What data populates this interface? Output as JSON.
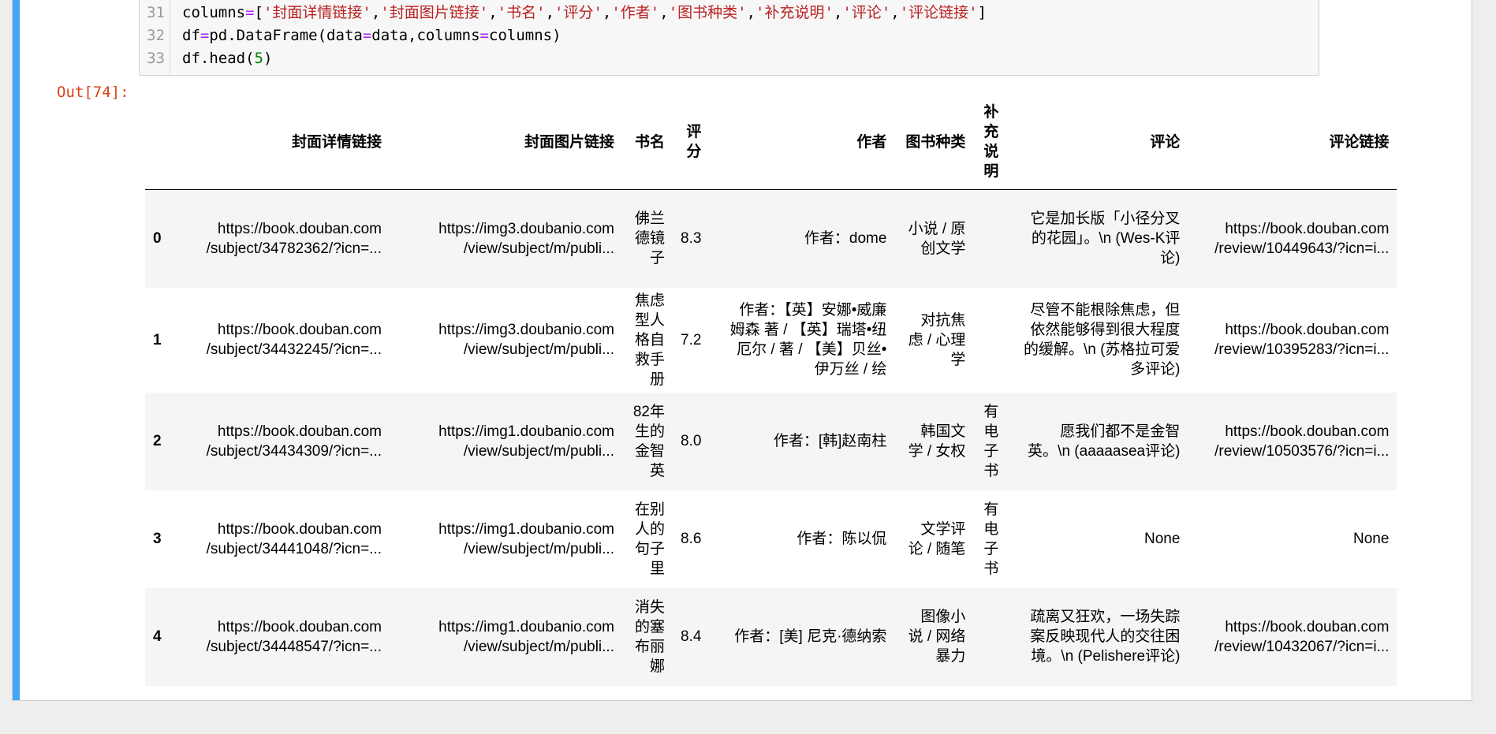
{
  "code": {
    "lines": [
      {
        "num": "31",
        "segments": [
          {
            "t": "columns",
            "c": ""
          },
          {
            "t": "=",
            "c": "tok-op"
          },
          {
            "t": "[",
            "c": ""
          },
          {
            "t": "'封面详情链接'",
            "c": "tok-str"
          },
          {
            "t": ",",
            "c": ""
          },
          {
            "t": "'封面图片链接'",
            "c": "tok-str"
          },
          {
            "t": ",",
            "c": ""
          },
          {
            "t": "'书名'",
            "c": "tok-str"
          },
          {
            "t": ",",
            "c": ""
          },
          {
            "t": "'评分'",
            "c": "tok-str"
          },
          {
            "t": ",",
            "c": ""
          },
          {
            "t": "'作者'",
            "c": "tok-str"
          },
          {
            "t": ",",
            "c": ""
          },
          {
            "t": "'图书种类'",
            "c": "tok-str"
          },
          {
            "t": ",",
            "c": ""
          },
          {
            "t": "'补充说明'",
            "c": "tok-str"
          },
          {
            "t": ",",
            "c": ""
          },
          {
            "t": "'评论'",
            "c": "tok-str"
          },
          {
            "t": ",",
            "c": ""
          },
          {
            "t": "'评论链接'",
            "c": "tok-str"
          },
          {
            "t": "]",
            "c": ""
          }
        ]
      },
      {
        "num": "32",
        "segments": [
          {
            "t": "df",
            "c": ""
          },
          {
            "t": "=",
            "c": "tok-op"
          },
          {
            "t": "pd.DataFrame(data",
            "c": ""
          },
          {
            "t": "=",
            "c": "tok-op"
          },
          {
            "t": "data,columns",
            "c": ""
          },
          {
            "t": "=",
            "c": "tok-op"
          },
          {
            "t": "columns)",
            "c": ""
          }
        ]
      },
      {
        "num": "33",
        "segments": [
          {
            "t": "df.head(",
            "c": ""
          },
          {
            "t": "5",
            "c": "tok-num"
          },
          {
            "t": ")",
            "c": ""
          }
        ]
      }
    ]
  },
  "output": {
    "prompt": "Out[74]:"
  },
  "table": {
    "columns": [
      "封面详情链接",
      "封面图片链接",
      "书名",
      "评分",
      "作者",
      "图书种类",
      "补充说明",
      "评论",
      "评论链接"
    ],
    "rows": [
      {
        "index": "0",
        "cells": [
          "https://book.douban.com\n/subject/34782362/?icn=...",
          "https://img3.doubanio.com\n/view/subject/m/publi...",
          "佛兰\n德镜\n子",
          "8.3",
          "作者：dome",
          "小说 / 原\n创文学",
          "",
          "它是加长版「小径分叉\n的花园」。\\n (Wes-K评\n论)",
          "https://book.douban.com\n/review/10449643/?icn=i..."
        ]
      },
      {
        "index": "1",
        "cells": [
          "https://book.douban.com\n/subject/34432245/?icn=...",
          "https://img3.doubanio.com\n/view/subject/m/publi...",
          "焦虑\n型人\n格自\n救手\n册",
          "7.2",
          "作者：【英】安娜•威廉\n姆森 著 / 【英】瑞塔•纽\n厄尔 / 著 / 【美】贝丝•\n伊万丝 / 绘",
          "对抗焦\n虑 / 心理\n学",
          "",
          "尽管不能根除焦虑，但\n依然能够得到很大程度\n的缓解。\\n (苏格拉可爱\n多评论)",
          "https://book.douban.com\n/review/10395283/?icn=i..."
        ]
      },
      {
        "index": "2",
        "cells": [
          "https://book.douban.com\n/subject/34434309/?icn=...",
          "https://img1.doubanio.com\n/view/subject/m/publi...",
          "82年\n生的\n金智\n英",
          "8.0",
          "作者：[韩]赵南柱",
          "韩国文\n学 / 女权",
          "有\n电\n子\n书",
          "愿我们都不是金智\n英。\\n (aaaaasea评论)",
          "https://book.douban.com\n/review/10503576/?icn=i..."
        ]
      },
      {
        "index": "3",
        "cells": [
          "https://book.douban.com\n/subject/34441048/?icn=...",
          "https://img1.doubanio.com\n/view/subject/m/publi...",
          "在别\n人的\n句子\n里",
          "8.6",
          "作者：陈以侃",
          "文学评\n论 / 随笔",
          "有\n电\n子\n书",
          "None",
          "None"
        ]
      },
      {
        "index": "4",
        "cells": [
          "https://book.douban.com\n/subject/34448547/?icn=...",
          "https://img1.doubanio.com\n/view/subject/m/publi...",
          "消失\n的塞\n布丽\n娜",
          "8.4",
          "作者：[美] 尼克·德纳索",
          "图像小\n说 / 网络\n暴力",
          "",
          "疏离又狂欢，一场失踪\n案反映现代人的交往困\n境。\\n (Pelishere评论)",
          "https://book.douban.com\n/review/10432067/?icn=i..."
        ]
      }
    ]
  }
}
